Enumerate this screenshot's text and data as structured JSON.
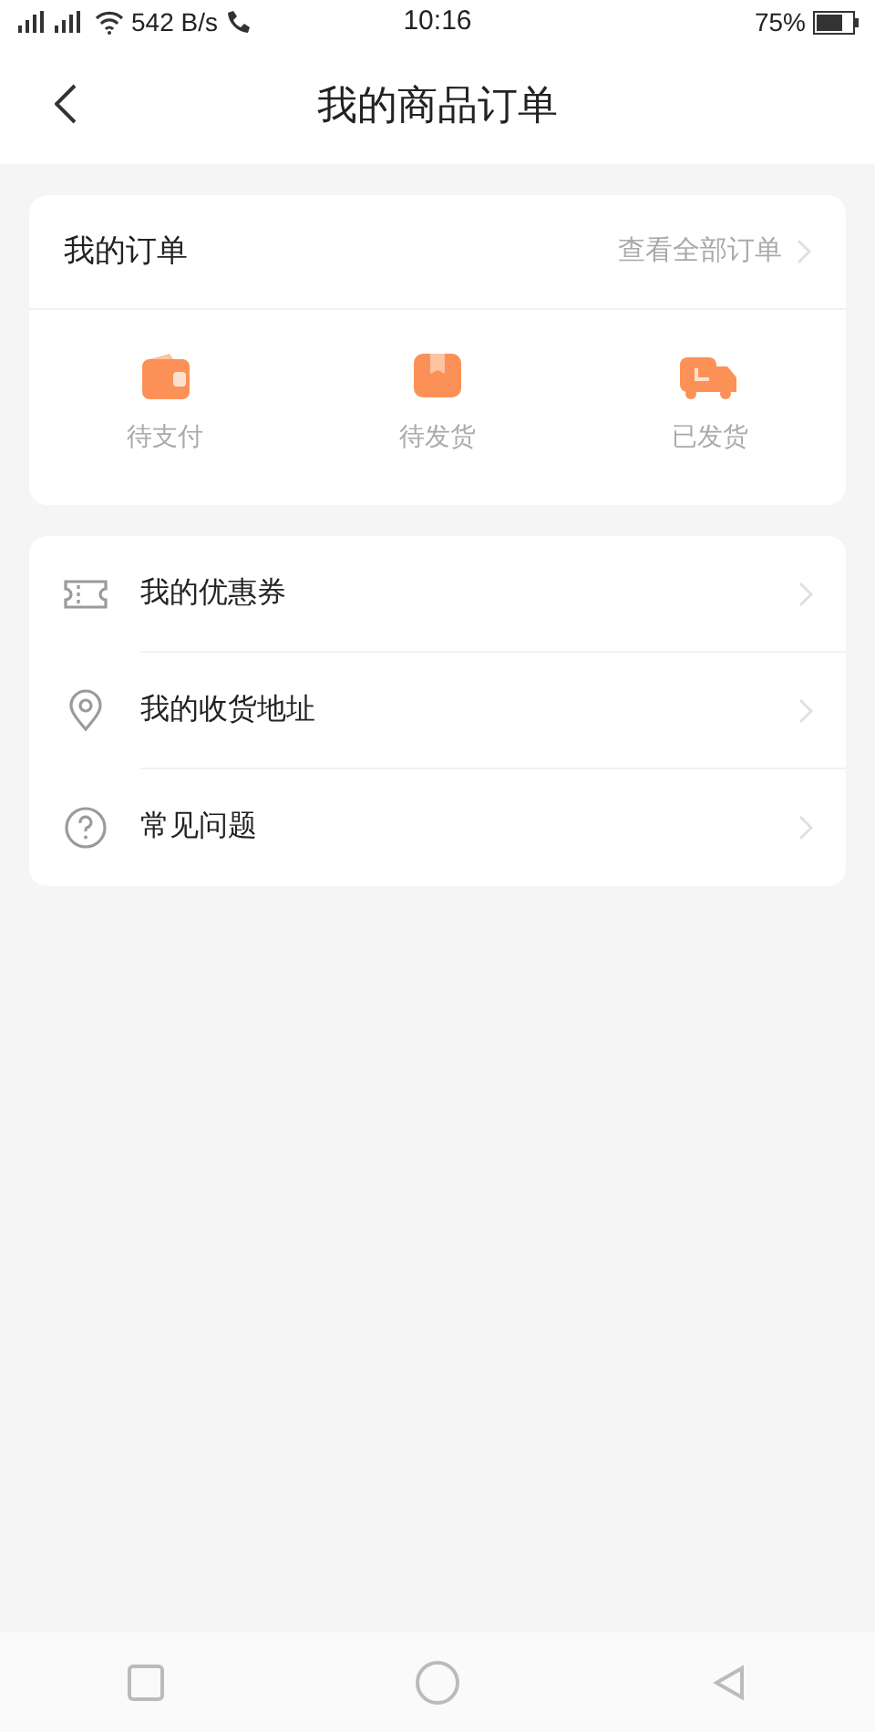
{
  "status_bar": {
    "speed": "542 B/s",
    "time": "10:16",
    "battery": "75%"
  },
  "header": {
    "title": "我的商品订单"
  },
  "orders": {
    "title": "我的订单",
    "view_all": "查看全部订单",
    "items": [
      {
        "kind": "wallet",
        "label": "待支付"
      },
      {
        "kind": "box",
        "label": "待发货"
      },
      {
        "kind": "truck",
        "label": "已发货"
      }
    ]
  },
  "menu": [
    {
      "kind": "coupon",
      "label": "我的优惠券"
    },
    {
      "kind": "location",
      "label": "我的收货地址"
    },
    {
      "kind": "question",
      "label": "常见问题"
    }
  ]
}
